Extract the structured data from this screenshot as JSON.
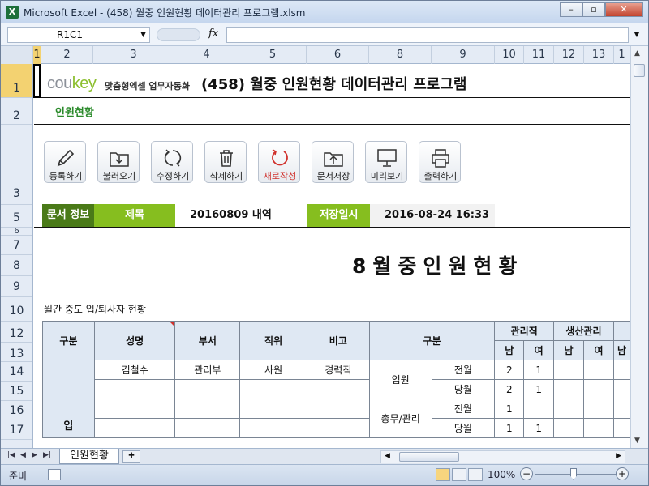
{
  "window": {
    "title": "Microsoft Excel - (458) 월중 인원현황 데이터관리 프로그램.xlsm"
  },
  "formula_bar": {
    "name_box": "R1C1",
    "fx": "fx",
    "content": ""
  },
  "columns": [
    "1",
    "2",
    "3",
    "4",
    "5",
    "6",
    "8",
    "9",
    "10",
    "11",
    "12",
    "13",
    "1"
  ],
  "rows": [
    "1",
    "2",
    "3",
    "5",
    "6",
    "7",
    "8",
    "9",
    "10",
    "12",
    "13",
    "14",
    "15",
    "16",
    "17"
  ],
  "header": {
    "logo_part1": "cou",
    "logo_part2": "key",
    "logo_tag": "맞춤형엑셀 업무자동화",
    "title": "(458) 월중 인원현황 데이터관리 프로그램",
    "subtitle": "인원현황"
  },
  "toolbar": [
    {
      "label": "등록하기",
      "icon": "pencil-icon"
    },
    {
      "label": "불러오기",
      "icon": "folder-download-icon"
    },
    {
      "label": "수정하기",
      "icon": "refresh-icon"
    },
    {
      "label": "삭제하기",
      "icon": "trash-icon"
    },
    {
      "label": "새로작성",
      "icon": "new-circle-icon"
    },
    {
      "label": "문서저장",
      "icon": "folder-upload-icon"
    },
    {
      "label": "미리보기",
      "icon": "monitor-icon"
    },
    {
      "label": "출력하기",
      "icon": "printer-icon"
    }
  ],
  "doc_info": {
    "section_label": "문서 정보",
    "title_label": "제목",
    "title_value": "20160809 내역",
    "saved_label": "저장일시",
    "saved_value": "2016-08-24 16:33"
  },
  "report": {
    "big_title": "8월중인원현황",
    "caption": "월간 중도 입/퇴사자 현황"
  },
  "table": {
    "headers": {
      "gubun": "구분",
      "name": "성명",
      "dept": "부서",
      "position": "직위",
      "note": "비고",
      "gubun2": "구분",
      "admin": "관리직",
      "production": "생산관리",
      "male": "남",
      "female": "여"
    },
    "rows": [
      {
        "name": "김철수",
        "dept": "관리부",
        "position": "사원",
        "note": "경력직",
        "group": "임원",
        "period": "전월",
        "admin_m": "2",
        "admin_f": "1",
        "prod_m": "",
        "prod_f": ""
      },
      {
        "name": "",
        "dept": "",
        "position": "",
        "note": "",
        "group": "",
        "period": "당월",
        "admin_m": "2",
        "admin_f": "1",
        "prod_m": "",
        "prod_f": ""
      },
      {
        "name": "",
        "dept": "",
        "position": "",
        "note": "",
        "group": "총무/관리",
        "period": "전월",
        "admin_m": "1",
        "admin_f": "",
        "prod_m": "",
        "prod_f": ""
      },
      {
        "name": "",
        "dept": "",
        "position": "",
        "note": "",
        "group": "",
        "period": "당월",
        "admin_m": "1",
        "admin_f": "1",
        "prod_m": "",
        "prod_f": ""
      }
    ],
    "section_in": "입"
  },
  "sheet_tab": "인원현황",
  "status": {
    "ready": "준비",
    "zoom": "100%"
  }
}
